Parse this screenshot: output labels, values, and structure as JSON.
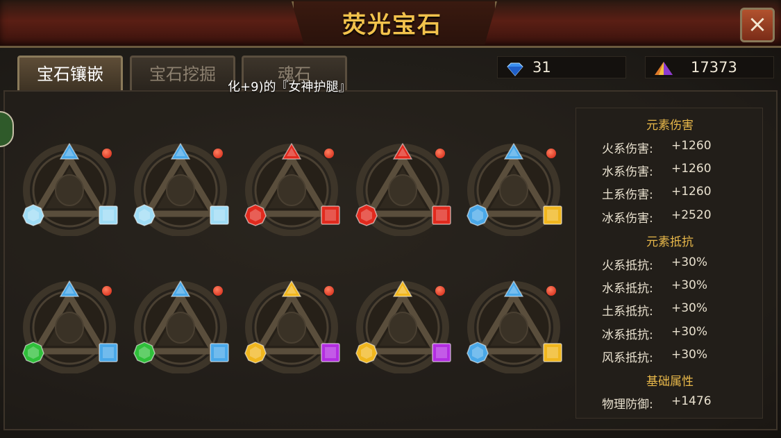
{
  "header": {
    "title": "荧光宝石",
    "close_icon": "×"
  },
  "tabs": [
    {
      "label": "宝石镶嵌",
      "active": true
    },
    {
      "label": "宝石挖掘",
      "active": false
    },
    {
      "label": "魂石",
      "active": false
    }
  ],
  "currency": {
    "diamond": {
      "icon": "diamond-icon",
      "value": "31"
    },
    "crystal": {
      "icon": "crystal-icon",
      "value": "17373"
    }
  },
  "tooltip": "化+9)的『女神护腿』",
  "equipment_slots": [
    {
      "item": "helmet-icon",
      "top_gem": "blue",
      "left_gem": "light-blue",
      "right_gem": "light-blue",
      "dot": true
    },
    {
      "item": "weapon-icon",
      "top_gem": "blue",
      "left_gem": "light-blue",
      "right_gem": "light-blue",
      "dot": true
    },
    {
      "item": "necklace-icon",
      "top_gem": "red",
      "left_gem": "red",
      "right_gem": "red",
      "dot": true
    },
    {
      "item": "bracer-icon",
      "top_gem": "red",
      "left_gem": "red",
      "right_gem": "red",
      "dot": true
    },
    {
      "item": "ring-icon",
      "top_gem": "blue",
      "left_gem": "blue",
      "right_gem": "gold",
      "dot": true
    },
    {
      "item": "armor-icon",
      "top_gem": "blue",
      "left_gem": "green",
      "right_gem": "blue",
      "dot": true
    },
    {
      "item": "shield-icon",
      "top_gem": "blue",
      "left_gem": "green",
      "right_gem": "blue",
      "dot": true
    },
    {
      "item": "leggings-icon",
      "top_gem": "gold",
      "left_gem": "gold",
      "right_gem": "purple",
      "dot": true
    },
    {
      "item": "boots-icon",
      "top_gem": "gold",
      "left_gem": "gold",
      "right_gem": "purple",
      "dot": true
    },
    {
      "item": "ring2-icon",
      "top_gem": "blue",
      "left_gem": "blue",
      "right_gem": "gold",
      "dot": true
    }
  ],
  "gem_colors": {
    "blue": "#4aa8e8",
    "light-blue": "#9fdcf5",
    "red": "#e02a1e",
    "gold": "#f0b61e",
    "green": "#2fbf3a",
    "purple": "#b22ee0",
    "sapphire": "#1f6fe0"
  },
  "stats": {
    "section1": "元素伤害",
    "damage": [
      {
        "label": "火系伤害:",
        "value": "+1260"
      },
      {
        "label": "水系伤害:",
        "value": "+1260"
      },
      {
        "label": "土系伤害:",
        "value": "+1260"
      },
      {
        "label": "冰系伤害:",
        "value": "+2520"
      }
    ],
    "section2": "元素抵抗",
    "resist": [
      {
        "label": "火系抵抗:",
        "value": "+30%"
      },
      {
        "label": "水系抵抗:",
        "value": "+30%"
      },
      {
        "label": "土系抵抗:",
        "value": "+30%"
      },
      {
        "label": "冰系抵抗:",
        "value": "+30%"
      },
      {
        "label": "风系抵抗:",
        "value": "+30%"
      }
    ],
    "section3": "基础属性",
    "base": [
      {
        "label": "物理防御:",
        "value": "+1476"
      }
    ]
  }
}
